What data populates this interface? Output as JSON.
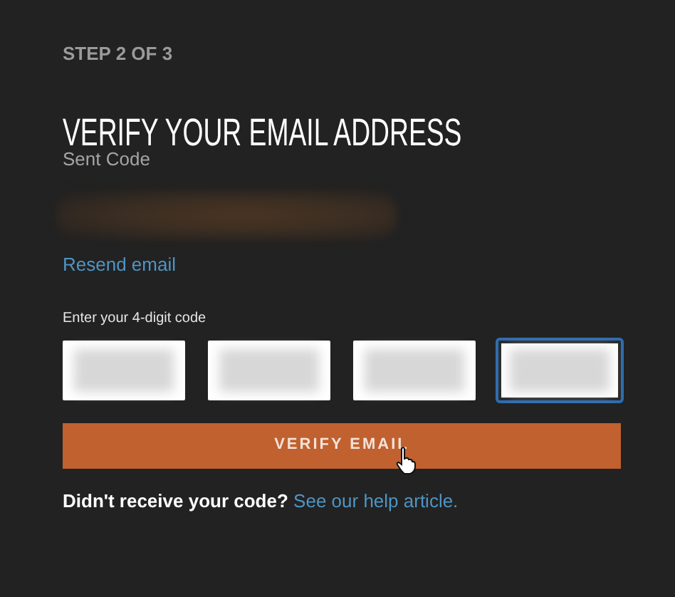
{
  "step": "STEP 2 OF 3",
  "title": "VERIFY YOUR EMAIL ADDRESS",
  "sent_code": {
    "label": "Sent Code",
    "kind": "redacted"
  },
  "resend_link": "Resend email",
  "code_entry": {
    "label": "Enter your 4-digit code",
    "inputs": [
      {
        "focused": false
      },
      {
        "focused": false
      },
      {
        "focused": false
      },
      {
        "focused": true
      }
    ]
  },
  "verify_button": "VERIFY EMAIL",
  "help": {
    "text": "Didn't receive your code?",
    "link": "See our help article."
  }
}
